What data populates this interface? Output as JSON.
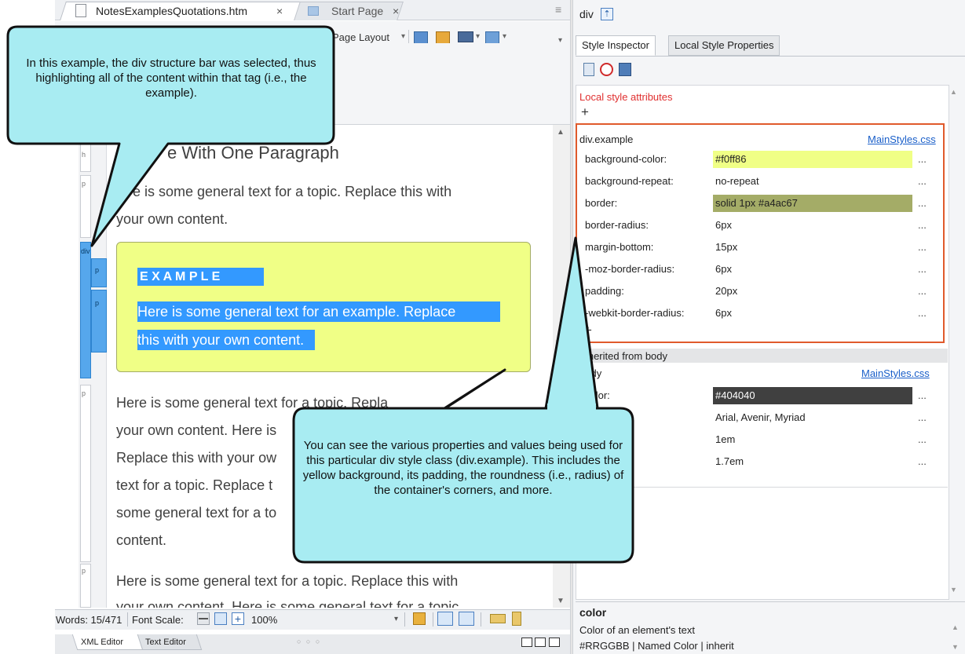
{
  "editor": {
    "active_tab": "NotesExamplesQuotations.htm",
    "inactive_tab": "Start Page",
    "tab_close": "×",
    "toolbar_page_layout": "Page Layout",
    "heading_fragment": "e With One Paragraph",
    "para1_line1": "re is some general text for a topic. Replace this with",
    "para1_line2": "your own content.",
    "example_heading": "E X A M P L E",
    "example_line1": "Here is some general text for an example. Replace",
    "example_line2": "this with your own content.",
    "para2_lines": [
      "Here is some general text for a topic. Repla",
      "your own content. Here is",
      "Replace this with your ow",
      "text for a topic. Replace t",
      "some general text for a to",
      "content."
    ],
    "para3_line1": "Here is some general text for a topic. Replace this with",
    "para3_line2": "your own content. Here is some general text for a topic",
    "structure": {
      "h": "h",
      "p": "p",
      "div": "div"
    },
    "status": {
      "words": "Words: 15/471",
      "font_scale_label": "Font Scale:",
      "zoom": "100%"
    },
    "bottom_tabs": [
      "XML Editor",
      "Text Editor"
    ],
    "dots": "○ ○ ○"
  },
  "inspector": {
    "element": "div",
    "tabs": [
      "Style Inspector",
      "Local Style Properties"
    ],
    "local_style_label": "Local style attributes",
    "plus": "+",
    "rule1": {
      "selector": "div.example",
      "source": "MainStyles.css",
      "props": [
        {
          "name": "background-color:",
          "value": "#f0ff86",
          "swatch": "#f0ff86",
          "text": "#222222"
        },
        {
          "name": "background-repeat:",
          "value": "no-repeat",
          "swatch": "",
          "text": "#222222"
        },
        {
          "name": "border:",
          "value": "solid 1px #a4ac67",
          "swatch": "#a4ac67",
          "text": "#222222"
        },
        {
          "name": "border-radius:",
          "value": "6px",
          "swatch": "",
          "text": "#222222"
        },
        {
          "name": "margin-bottom:",
          "value": "15px",
          "swatch": "",
          "text": "#222222"
        },
        {
          "name": "-moz-border-radius:",
          "value": "6px",
          "swatch": "",
          "text": "#222222"
        },
        {
          "name": "padding:",
          "value": "20px",
          "swatch": "",
          "text": "#222222"
        },
        {
          "name": "-webkit-border-radius:",
          "value": "6px",
          "swatch": "",
          "text": "#222222"
        }
      ]
    },
    "inherited_label": "Inherited from body",
    "rule2": {
      "selector": "body",
      "source": "MainStyles.css",
      "props": [
        {
          "name": "color:",
          "value": "#404040",
          "swatch": "#404040",
          "text": "#ffffff"
        },
        {
          "name": "y:",
          "value": "Arial, Avenir, Myriad",
          "swatch": "",
          "text": "#222222"
        },
        {
          "name": "",
          "value": "1em",
          "swatch": "",
          "text": "#222222"
        },
        {
          "name": "t:",
          "value": "1.7em",
          "swatch": "",
          "text": "#222222"
        }
      ]
    },
    "more": "...",
    "help_title": "color",
    "help_desc": "Color of an element's text",
    "help_syntax": "#RRGGBB | Named Color | inherit"
  },
  "callouts": {
    "top": "In this example, the div structure bar was selected, thus highlighting all of the content within that tag (i.e., the example).",
    "bottom": "You can see the various properties and values being used for this particular div style class (div.example). This includes the yellow background, its padding, the roundness (i.e., radius) of the container's corners, and more."
  },
  "colors": {
    "callout_fill": "#a8ecf2",
    "highlight_blue": "#3399ff",
    "rule_border": "#e05a2b",
    "local_style_red": "#e03030"
  }
}
